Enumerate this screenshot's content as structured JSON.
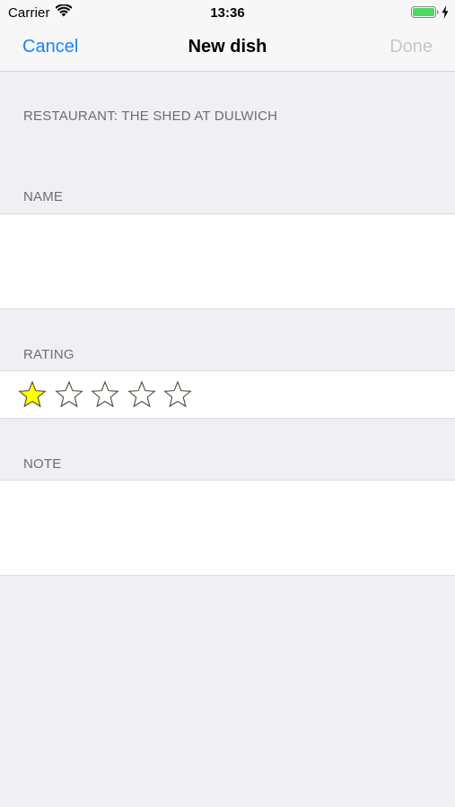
{
  "status_bar": {
    "carrier": "Carrier",
    "time": "13:36",
    "battery_level": 1.0,
    "charging": true,
    "icons": [
      "wifi-icon",
      "battery-icon",
      "charging-icon"
    ]
  },
  "nav": {
    "cancel_label": "Cancel",
    "title": "New dish",
    "done_label": "Done",
    "done_enabled": false
  },
  "form": {
    "restaurant_label": "RESTAURANT: THE SHED AT DULWICH",
    "name_header": "NAME",
    "name_value": "",
    "rating_header": "RATING",
    "rating": {
      "value": 1,
      "max": 5
    },
    "note_header": "NOTE",
    "note_value": ""
  },
  "colors": {
    "accent": "#1a82fb",
    "disabled": "#c7c7cc",
    "background": "#efeff4",
    "star_fill": "#ffff00",
    "star_outline": "#4a4a3a",
    "battery": "#4cd964"
  }
}
